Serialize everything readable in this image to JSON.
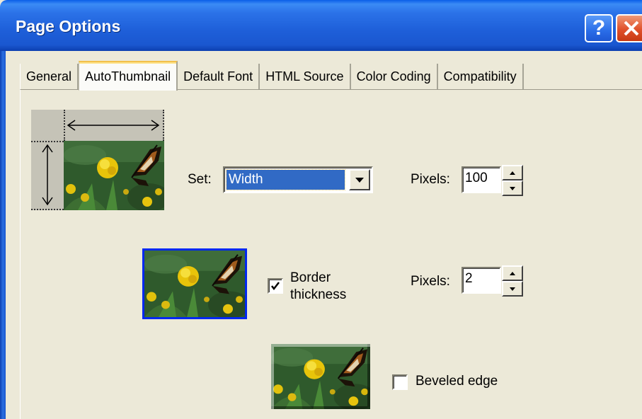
{
  "window": {
    "title": "Page Options",
    "help_label": "?",
    "close_label": "X"
  },
  "tabs": [
    {
      "label": "General",
      "active": false
    },
    {
      "label": "AutoThumbnail",
      "active": true
    },
    {
      "label": "Default Font",
      "active": false
    },
    {
      "label": "HTML Source",
      "active": false
    },
    {
      "label": "Color Coding",
      "active": false
    },
    {
      "label": "Compatibility",
      "active": false
    }
  ],
  "size": {
    "set_label": "Set:",
    "set_value": "Width",
    "pixels_label": "Pixels:",
    "pixels_value": "100"
  },
  "border": {
    "checkbox_label_line1": "Border",
    "checkbox_label_line2": "thickness",
    "checked": true,
    "pixels_label": "Pixels:",
    "pixels_value": "2",
    "color": "#0028f0"
  },
  "bevel": {
    "checkbox_label": "Beveled edge",
    "checked": false
  },
  "colors": {
    "title_bar": "#1e5fd9",
    "selection": "#316ac5",
    "dialog_bg": "#ece9d8"
  }
}
